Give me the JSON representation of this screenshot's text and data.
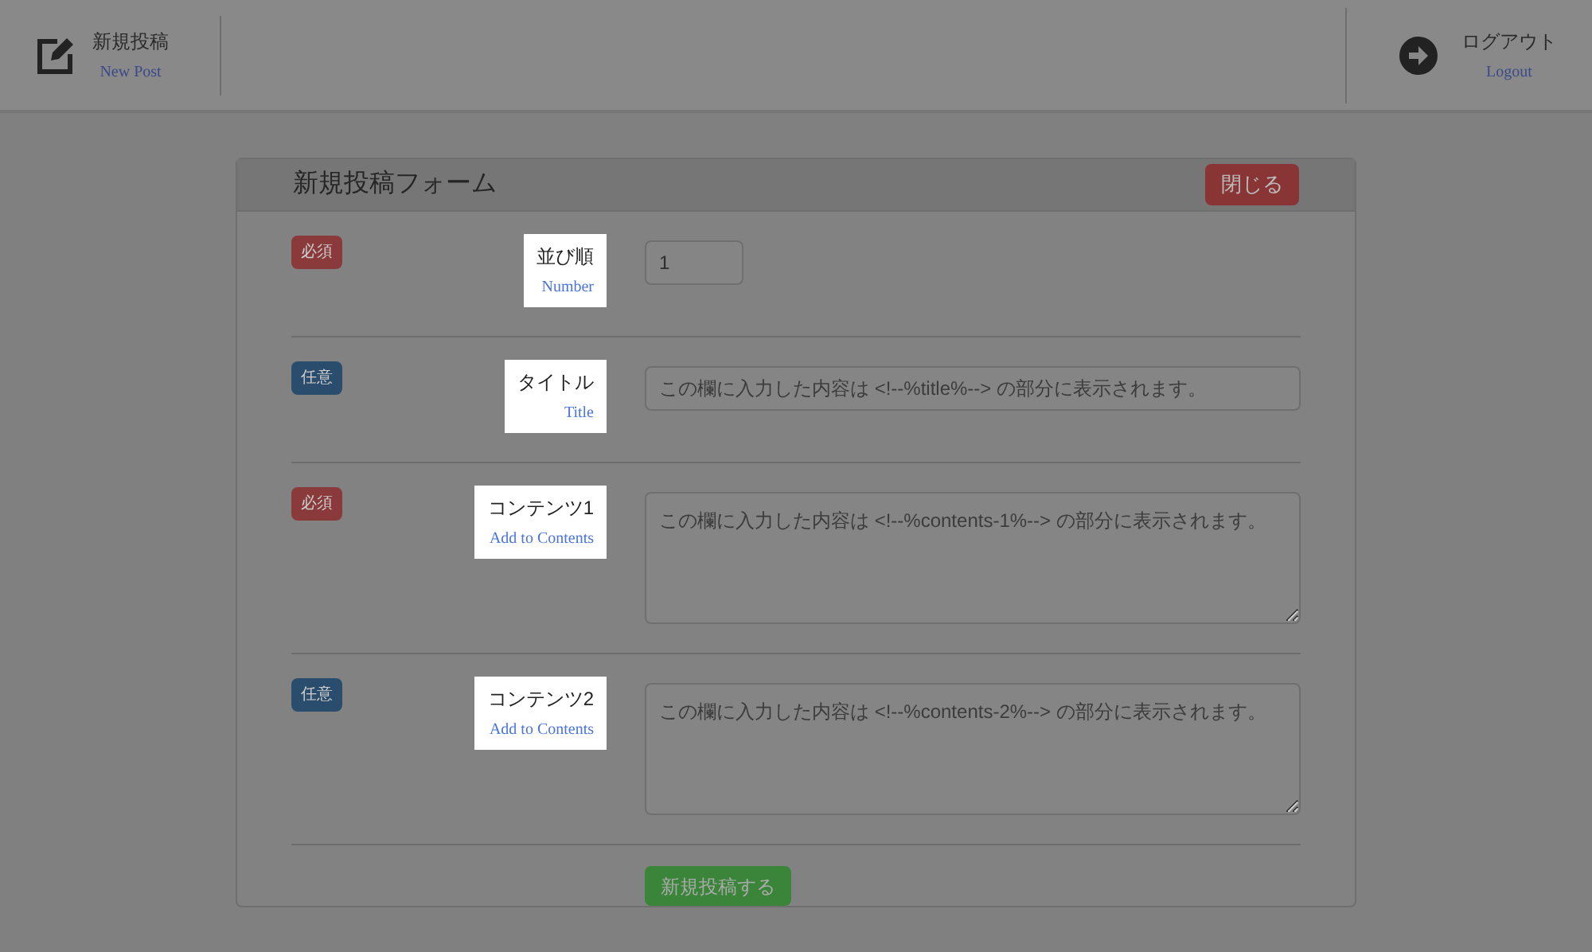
{
  "header": {
    "left": {
      "label": "新規投稿",
      "sublabel": "New Post"
    },
    "right": {
      "label": "ログアウト",
      "sublabel": "Logout"
    }
  },
  "form": {
    "title": "新規投稿フォーム",
    "close_button": "閉じる",
    "rows": [
      {
        "badge": {
          "kind": "required",
          "text": "必須"
        },
        "label": "並び順",
        "sublabel": "Number",
        "field": {
          "kind": "short",
          "value": "1"
        }
      },
      {
        "badge": {
          "kind": "optional",
          "text": "任意"
        },
        "label": "タイトル",
        "sublabel": "Title",
        "field": {
          "kind": "line",
          "placeholder": "この欄に入力した内容は <!--%title%--> の部分に表示されます。"
        }
      },
      {
        "badge": {
          "kind": "required",
          "text": "必須"
        },
        "label": "コンテンツ1",
        "sublabel": "Add to Contents",
        "field": {
          "kind": "area",
          "placeholder": "この欄に入力した内容は <!--%contents-1%--> の部分に表示されます。"
        }
      },
      {
        "badge": {
          "kind": "optional",
          "text": "任意"
        },
        "label": "コンテンツ2",
        "sublabel": "Add to Contents",
        "field": {
          "kind": "area",
          "placeholder": "この欄に入力した内容は <!--%contents-2%--> の部分に表示されます。"
        }
      }
    ],
    "submit_button": "新規投稿する"
  }
}
